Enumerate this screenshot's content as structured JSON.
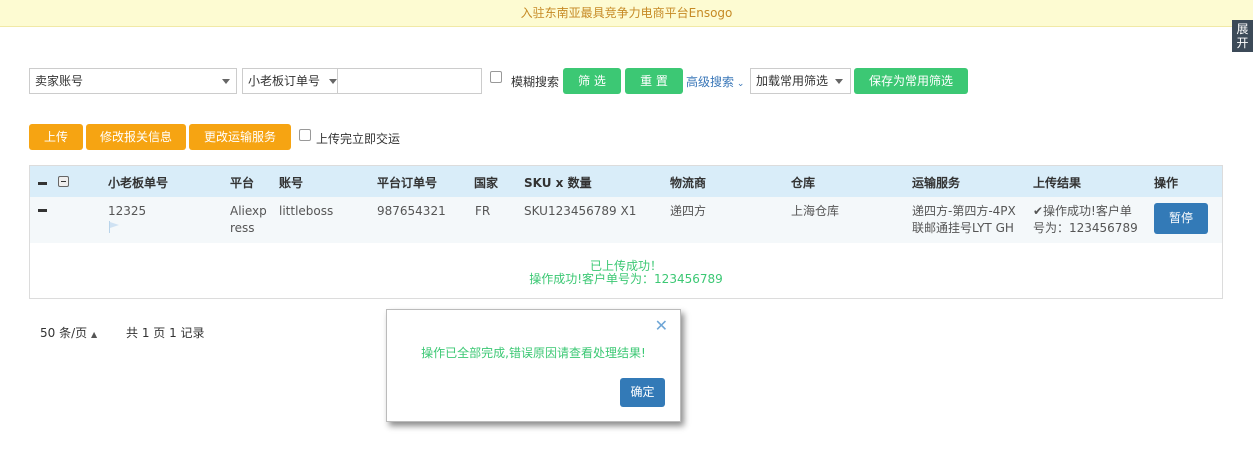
{
  "banner": {
    "text": "入驻东南亚最具竞争力电商平台Ensogo"
  },
  "side_tab": {
    "label_line1": "展",
    "label_line2": "开"
  },
  "filters": {
    "seller_account": "卖家账号",
    "order_field": "小老板订单号",
    "search_value": "",
    "fuzzy_label": "模糊搜索",
    "filter_btn": "筛 选",
    "reset_btn": "重 置",
    "advanced_link": "高级搜索",
    "load_filter": "加载常用筛选",
    "save_filter_btn": "保存为常用筛选"
  },
  "actions": {
    "upload_btn": "上传",
    "edit_customs_btn": "修改报关信息",
    "change_shipping_btn": "更改运输服务",
    "auto_ship_label": "上传完立即交运"
  },
  "table": {
    "headers": [
      "小老板单号",
      "平台",
      "账号",
      "平台订单号",
      "国家",
      "SKU x 数量",
      "物流商",
      "仓库",
      "运输服务",
      "上传结果",
      "操作"
    ],
    "row": {
      "order_no": "12325",
      "platform_line1": "Aliexp",
      "platform_line2": "ress",
      "account": "littleboss",
      "platform_order": "987654321",
      "country": "FR",
      "sku_qty": "SKU123456789 X1",
      "carrier": "递四方",
      "warehouse": "上海仓库",
      "service_line1": "递四方-第四方-4PX",
      "service_line2": "联邮通挂号LYT GH",
      "result_line1": "✔操作成功!客户单",
      "result_line2": "号为：123456789",
      "pause_btn": "暂停"
    },
    "detail_line1": "已上传成功！",
    "detail_line2": "操作成功!客户单号为：123456789"
  },
  "pager": {
    "page_size": "50 条/页",
    "summary": "共 1 页 1 记录"
  },
  "dialog": {
    "message": "操作已全部完成,错误原因请查看处理结果!",
    "ok_btn": "确定",
    "close_symbol": "✕"
  },
  "colors": {
    "green": "#3cc874",
    "orange": "#f6a412",
    "blue": "#337ab7",
    "header_bg": "#d9edf9"
  }
}
